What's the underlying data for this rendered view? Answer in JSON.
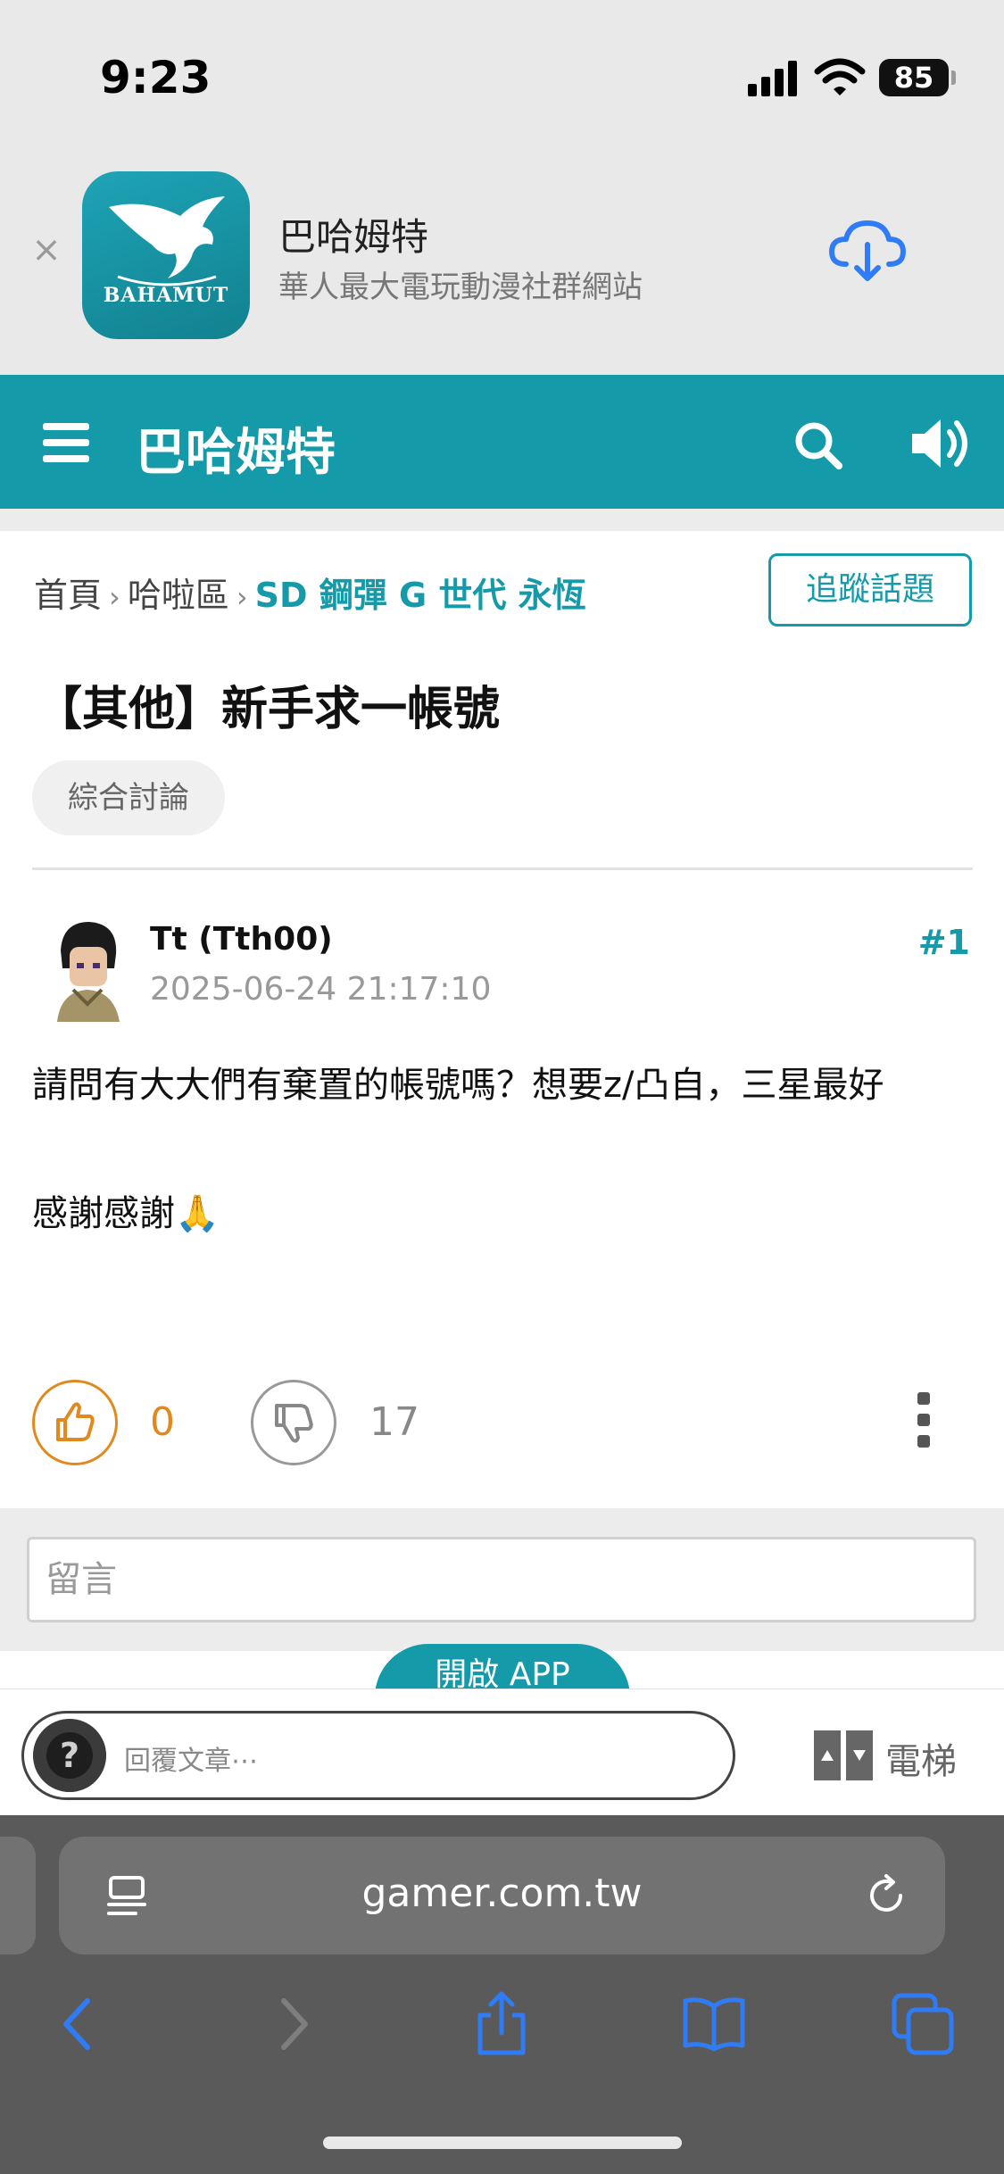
{
  "status_bar": {
    "time": "9:23",
    "battery": "85"
  },
  "app_banner": {
    "icon_text": "BAHAMUT",
    "name": "巴哈姆特",
    "description": "華人最大電玩動漫社群網站"
  },
  "nav": {
    "title": "巴哈姆特"
  },
  "breadcrumb": {
    "home": "首頁",
    "section": "哈啦區",
    "current": "SD 鋼彈 G 世代 永恆"
  },
  "follow_label": "追蹤話題",
  "post": {
    "title": "【其他】新手求一帳號",
    "category": "綜合討論",
    "author": "Tt (Tth00)",
    "date": "2025-06-24 21:17:10",
    "floor": "#1",
    "body_line1": "請問有大大們有棄置的帳號嗎？想要z/凸自，三星最好",
    "body_line2": "感謝感謝🙏",
    "likes": "0",
    "dislikes": "17"
  },
  "comment": {
    "placeholder": "留言"
  },
  "open_app_label": "開啟 APP",
  "reply_bar": {
    "placeholder": "回覆文章⋯",
    "elevator_label": "電梯"
  },
  "browser": {
    "url": "gamer.com.tw"
  },
  "colors": {
    "accent": "#149aa8",
    "like": "#e08a1e",
    "safari_blue": "#2f7cf6"
  }
}
